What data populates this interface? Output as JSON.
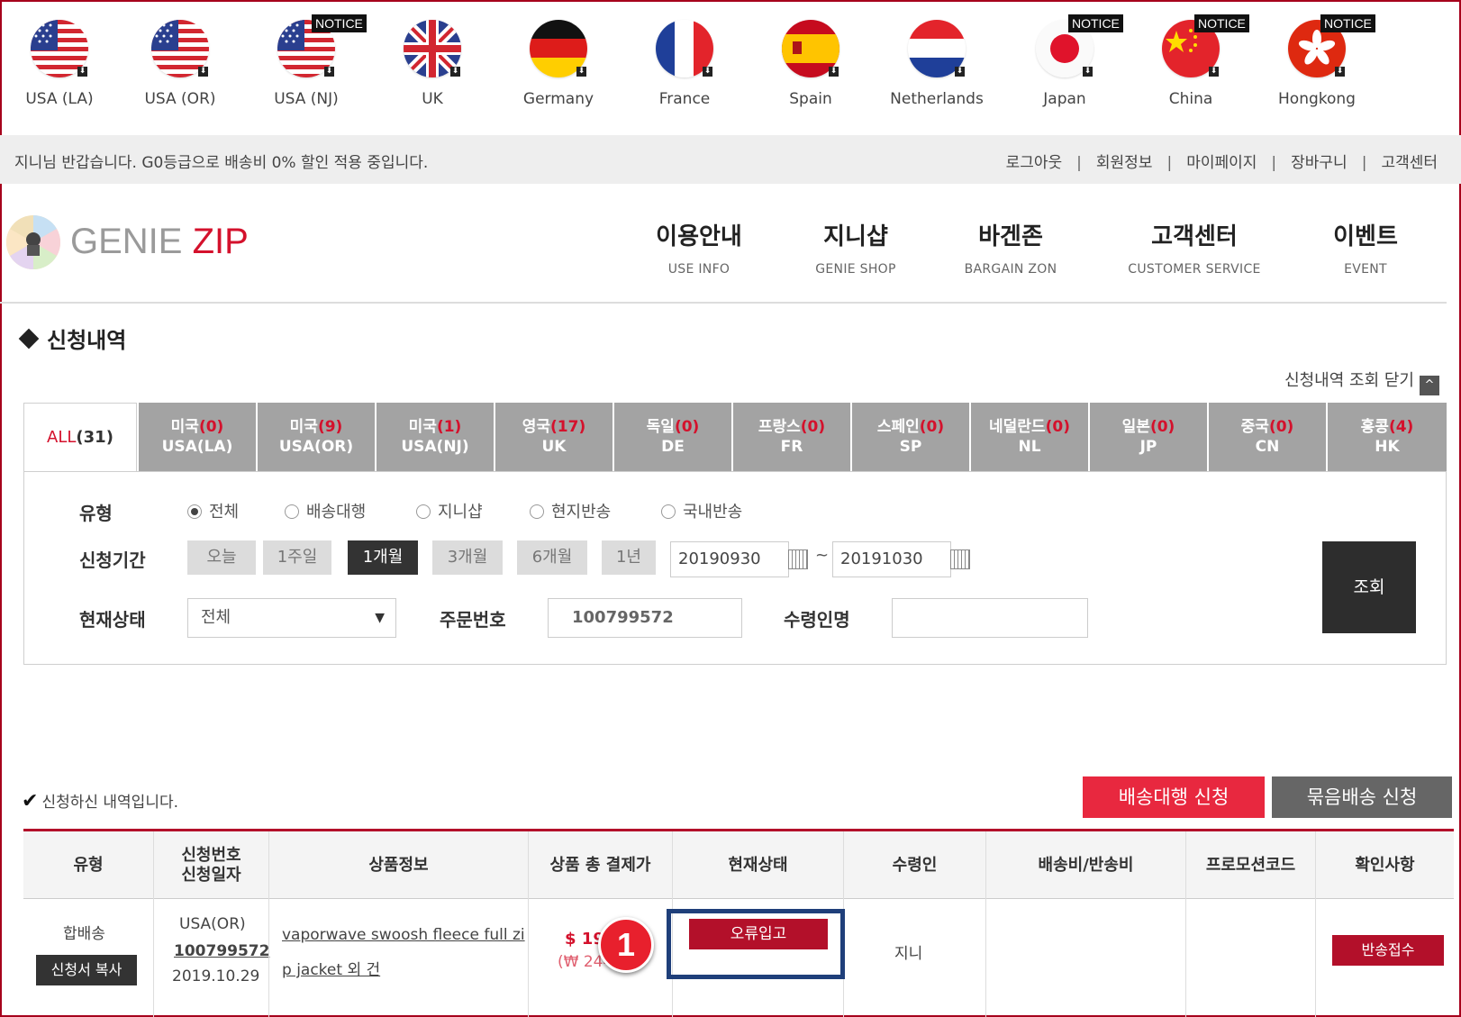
{
  "flags": [
    {
      "label": "USA (LA)",
      "icon": "us-flag-icon",
      "notice": ""
    },
    {
      "label": "USA (OR)",
      "icon": "us-flag-icon",
      "notice": ""
    },
    {
      "label": "USA (NJ)",
      "icon": "us-flag-icon",
      "notice": "NOTICE"
    },
    {
      "label": "UK",
      "icon": "uk-flag-icon",
      "notice": ""
    },
    {
      "label": "Germany",
      "icon": "germany-flag-icon",
      "notice": ""
    },
    {
      "label": "France",
      "icon": "france-flag-icon",
      "notice": ""
    },
    {
      "label": "Spain",
      "icon": "spain-flag-icon",
      "notice": ""
    },
    {
      "label": "Netherlands",
      "icon": "netherlands-flag-icon",
      "notice": ""
    },
    {
      "label": "Japan",
      "icon": "japan-flag-icon",
      "notice": "NOTICE"
    },
    {
      "label": "China",
      "icon": "china-flag-icon",
      "notice": "NOTICE"
    },
    {
      "label": "Hongkong",
      "icon": "hongkong-flag-icon",
      "notice": "NOTICE"
    }
  ],
  "greeting": {
    "message": "지니님  반갑습니다. G0등급으로 배송비 0% 할인 적용 중입니다.",
    "links": [
      "로그아웃",
      "회원정보",
      "마이페이지",
      "장바구니",
      "고객센터"
    ],
    "separator": "|"
  },
  "logo": {
    "part1": "GENIE ",
    "part2": "ZIP"
  },
  "nav": [
    {
      "ko": "이용안내",
      "en": "USE INFO"
    },
    {
      "ko": "지니샵",
      "en": "GENIE SHOP"
    },
    {
      "ko": "바겐존",
      "en": "BARGAIN ZON"
    },
    {
      "ko": "고객센터",
      "en": "CUSTOMER SERVICE"
    },
    {
      "ko": "이벤트",
      "en": "EVENT"
    }
  ],
  "section": {
    "title": "신청내역",
    "close_label": "신청내역 조회 닫기",
    "close_icon": "^"
  },
  "tabs": [
    {
      "name": "ALL",
      "count": "(31)",
      "sub": ""
    },
    {
      "name": "미국",
      "count": "(0)",
      "sub": "USA(LA)"
    },
    {
      "name": "미국",
      "count": "(9)",
      "sub": "USA(OR)"
    },
    {
      "name": "미국",
      "count": "(1)",
      "sub": "USA(NJ)"
    },
    {
      "name": "영국",
      "count": "(17)",
      "sub": "UK"
    },
    {
      "name": "독일",
      "count": "(0)",
      "sub": "DE"
    },
    {
      "name": "프랑스",
      "count": "(0)",
      "sub": "FR"
    },
    {
      "name": "스페인",
      "count": "(0)",
      "sub": "SP"
    },
    {
      "name": "네덜란드",
      "count": "(0)",
      "sub": "NL"
    },
    {
      "name": "일본",
      "count": "(0)",
      "sub": "JP"
    },
    {
      "name": "중국",
      "count": "(0)",
      "sub": "CN"
    },
    {
      "name": "홍콩",
      "count": "(4)",
      "sub": "HK"
    }
  ],
  "filters": {
    "type_label": "유형",
    "type_options": [
      "전체",
      "배송대행",
      "지니샵",
      "현지반송",
      "국내반송"
    ],
    "type_selected": "전체",
    "period_label": "신청기간",
    "period_buttons": [
      "오늘",
      "1주일",
      "1개월",
      "3개월",
      "6개월",
      "1년"
    ],
    "period_selected": "1개월",
    "date_from": "20190930",
    "date_to": "20191030",
    "tilde": "~",
    "status_label": "현재상태",
    "status_value": "전체",
    "status_arrow": "▼",
    "order_label": "주문번호",
    "order_value": "100799572",
    "recipient_label": "수령인명",
    "recipient_value": "",
    "search_button": "조회"
  },
  "results": {
    "note": "신청하신 내역입니다.",
    "check_icon": "✔",
    "btn_shipping": "배송대행 신청",
    "btn_bundle": "묶음배송 신청"
  },
  "table": {
    "headers": [
      {
        "l1": "유형",
        "l2": ""
      },
      {
        "l1": "신청번호",
        "l2": "신청일자"
      },
      {
        "l1": "상품정보",
        "l2": ""
      },
      {
        "l1": "상품 총 결제가",
        "l2": ""
      },
      {
        "l1": "현재상태",
        "l2": ""
      },
      {
        "l1": "수령인",
        "l2": ""
      },
      {
        "l1": "배송비/반송비",
        "l2": ""
      },
      {
        "l1": "프로모션코드",
        "l2": ""
      },
      {
        "l1": "확인사항",
        "l2": ""
      }
    ],
    "row": {
      "type": "합배송",
      "copy_button": "신청서 복사",
      "region": "USA(OR)",
      "order_no": "100799572",
      "date": "2019.10.29",
      "product_line1": "vaporwave swoosh fleece full zi",
      "product_line2": "p jacket 외 건",
      "price_usd": "$ 19",
      "price_krw": "(₩ 244",
      "status_button": "오류입고",
      "recipient": "지니",
      "action_button": "반송접수"
    }
  },
  "annotation": {
    "step": "1"
  }
}
